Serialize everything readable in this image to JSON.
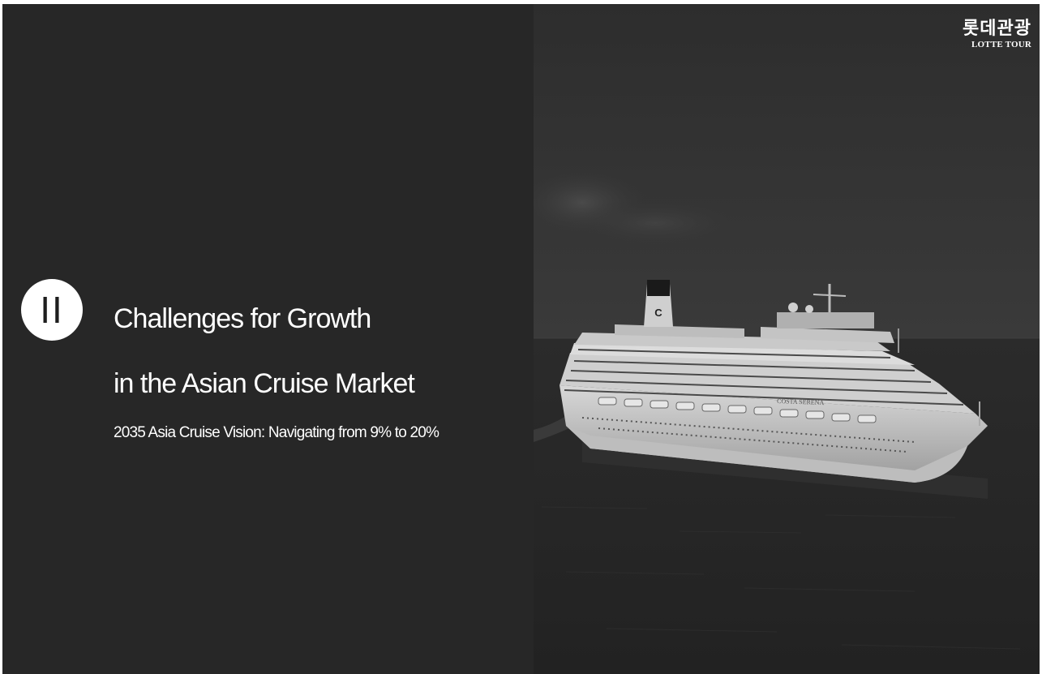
{
  "section": {
    "numeral": "II"
  },
  "title": {
    "line1": "Challenges for Growth",
    "line2": "in the Asian Cruise Market"
  },
  "subtitle": "2035 Asia Cruise Vision: Navigating from 9% to 20%",
  "logo": {
    "korean": "롯데관광",
    "english": "LOTTE TOUR"
  },
  "photo": {
    "subject": "cruise-ship-at-sea",
    "ship_name": "COSTA SERENA",
    "funnel_letter": "C"
  },
  "colors": {
    "background": "#272727",
    "text": "#ffffff",
    "badge": "#ffffff"
  }
}
